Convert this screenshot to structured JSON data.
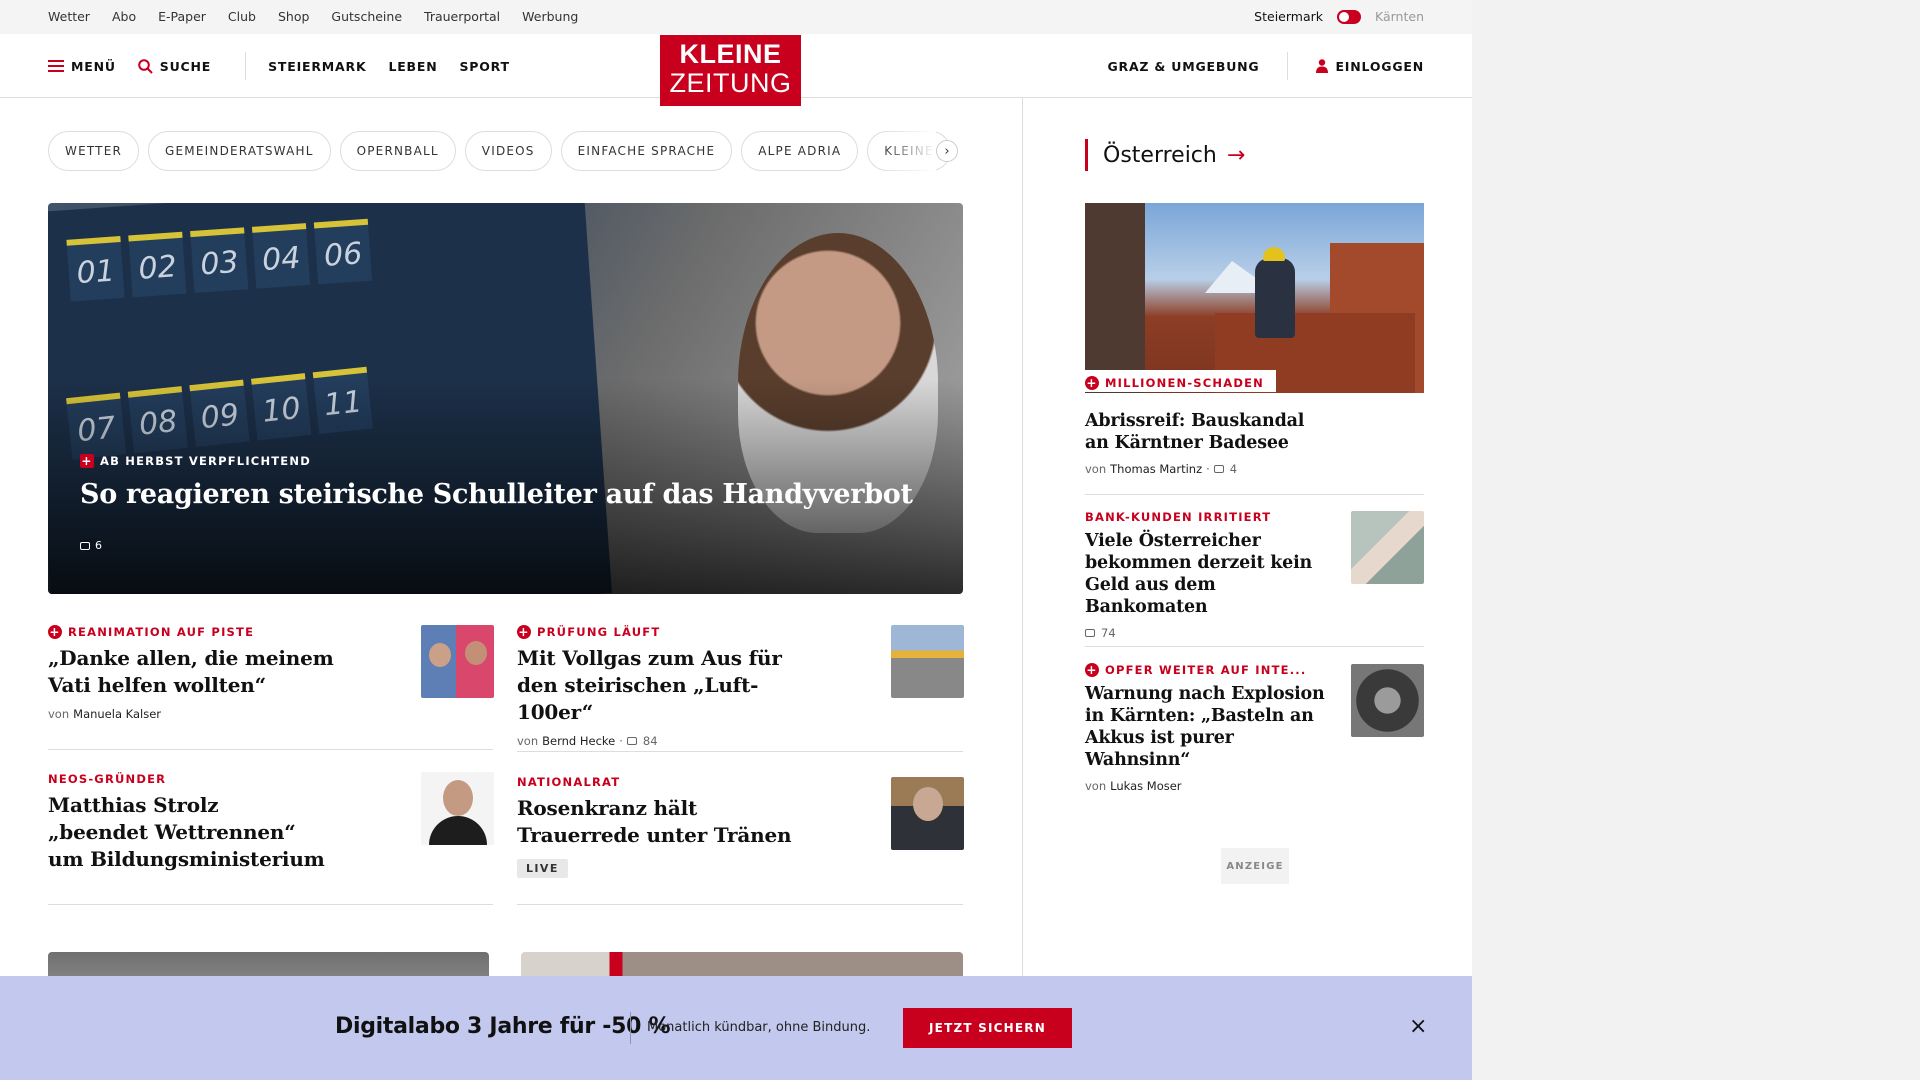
{
  "topbar": {
    "links": [
      "Wetter",
      "Abo",
      "E-Paper",
      "Club",
      "Shop",
      "Gutscheine",
      "Trauerportal",
      "Werbung"
    ],
    "region_active": "Steiermark",
    "region_inactive": "Kärnten"
  },
  "nav": {
    "menu": "MENÜ",
    "search": "SUCHE",
    "sections": [
      "STEIERMARK",
      "LEBEN",
      "SPORT"
    ],
    "region": "GRAZ & UMGEBUNG",
    "login": "EINLOGGEN"
  },
  "logo": {
    "line1": "KLEINE",
    "line2": "ZEITUNG"
  },
  "chips": [
    "WETTER",
    "GEMEINDERATSWAHL",
    "OPERNBALL",
    "VIDEOS",
    "EINFACHE SPRACHE",
    "ALPE ADRIA",
    "KLEINE"
  ],
  "chips_next": "›",
  "hero": {
    "pocket_numbers": [
      "01",
      "02",
      "03",
      "04",
      "06",
      "07",
      "08",
      "09",
      "10",
      "11"
    ],
    "kicker": "AB HERBST VERPFLICHTEND",
    "title": "So reagieren steirische Schulleiter auf das Handyverbot",
    "comments": "6"
  },
  "articles": [
    {
      "kicker": "REANIMATION AUF PISTE",
      "title_line1": "„Danke allen, die meinem",
      "title_line2": "Vati helfen wollten“",
      "by": "von",
      "author": "Manuela Kalser"
    },
    {
      "kicker": "PRÜFUNG LÄUFT",
      "title_line1": "Mit Vollgas zum Aus für",
      "title_line2": "den steirischen „Luft-100er“",
      "by": "von",
      "author": "Bernd Hecke",
      "comments": "84"
    },
    {
      "kicker": "NEOS-GRÜNDER",
      "title_line1": "Matthias Strolz",
      "title_line2": "„beendet Wettrennen“",
      "title_line3": "um Bildungsministerium"
    },
    {
      "kicker": "NATIONALRAT",
      "title_line1": "Rosenkranz hält",
      "title_line2": "Trauerrede unter Tränen",
      "badge": "LIVE"
    }
  ],
  "sidebar": {
    "section": "Österreich",
    "arrow": "→",
    "items": [
      {
        "kicker": "MILLIONEN-SCHADEN",
        "title_line1": "Abrissreif: Bauskandal",
        "title_line2": "an Kärntner Badesee",
        "by": "von",
        "author": "Thomas Martinz",
        "comments": "4"
      },
      {
        "kicker": "BANK-KUNDEN IRRITIERT",
        "title_line1": "Viele Österreicher",
        "title_line2": "bekommen derzeit kein",
        "title_line3": "Geld aus dem Bankomaten",
        "comments": "74"
      },
      {
        "kicker": "OPFER WEITER AUF INTE...",
        "title_line1": "Warnung nach Explosion",
        "title_line2": "in Kärnten: „Basteln an",
        "title_line3": "Akkus ist purer Wahnsinn“",
        "by": "von",
        "author": "Lukas Moser"
      }
    ],
    "ad_label": "ANZEIGE"
  },
  "promo": {
    "headline": "Digitalabo 3 Jahre für -50 %",
    "sub": "Monatlich kündbar, ohne Bindung.",
    "cta": "JETZT SICHERN",
    "close": "×"
  },
  "colors": {
    "brand": "#c8001e",
    "promo_bg": "#c3c8ef",
    "gutter": "#f2f2f2"
  }
}
